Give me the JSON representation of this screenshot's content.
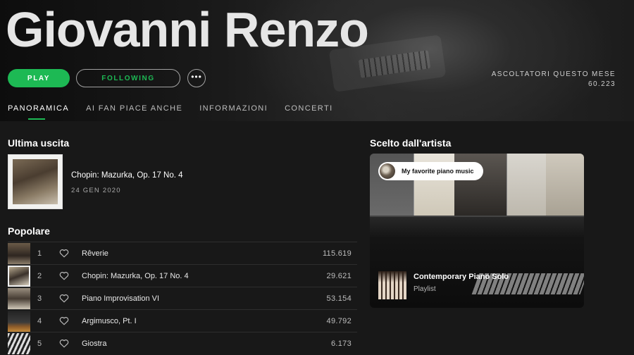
{
  "header": {
    "artist_name": "Giovanni Renzo",
    "play_label": "PLAY",
    "following_label": "FOLLOWING",
    "more_label": "•••",
    "listeners_label": "ASCOLTATORI QUESTO MESE",
    "listeners_count": "60.223"
  },
  "tabs": [
    {
      "label": "PANORAMICA",
      "active": true
    },
    {
      "label": "AI FAN PIACE ANCHE",
      "active": false
    },
    {
      "label": "INFORMAZIONI",
      "active": false
    },
    {
      "label": "CONCERTI",
      "active": false
    }
  ],
  "latest_release": {
    "section_title": "Ultima uscita",
    "title": "Chopin: Mazurka, Op. 17 No. 4",
    "date": "24 GEN 2020"
  },
  "popular": {
    "section_title": "Popolare",
    "tracks": [
      {
        "num": "1",
        "title": "Rêverie",
        "plays": "115.619"
      },
      {
        "num": "2",
        "title": "Chopin: Mazurka, Op. 17 No. 4",
        "plays": "29.621"
      },
      {
        "num": "3",
        "title": "Piano Improvisation VI",
        "plays": "53.154"
      },
      {
        "num": "4",
        "title": "Argimusco, Pt. I",
        "plays": "49.792"
      },
      {
        "num": "5",
        "title": "Giostra",
        "plays": "6.173"
      }
    ]
  },
  "artist_pick": {
    "section_title": "Scelto dall'artista",
    "chip_label": "My favorite piano music",
    "playlist_title": "Contemporary Piano Solo",
    "playlist_type": "Playlist"
  },
  "colors": {
    "accent": "#1db954",
    "background": "#181818"
  }
}
